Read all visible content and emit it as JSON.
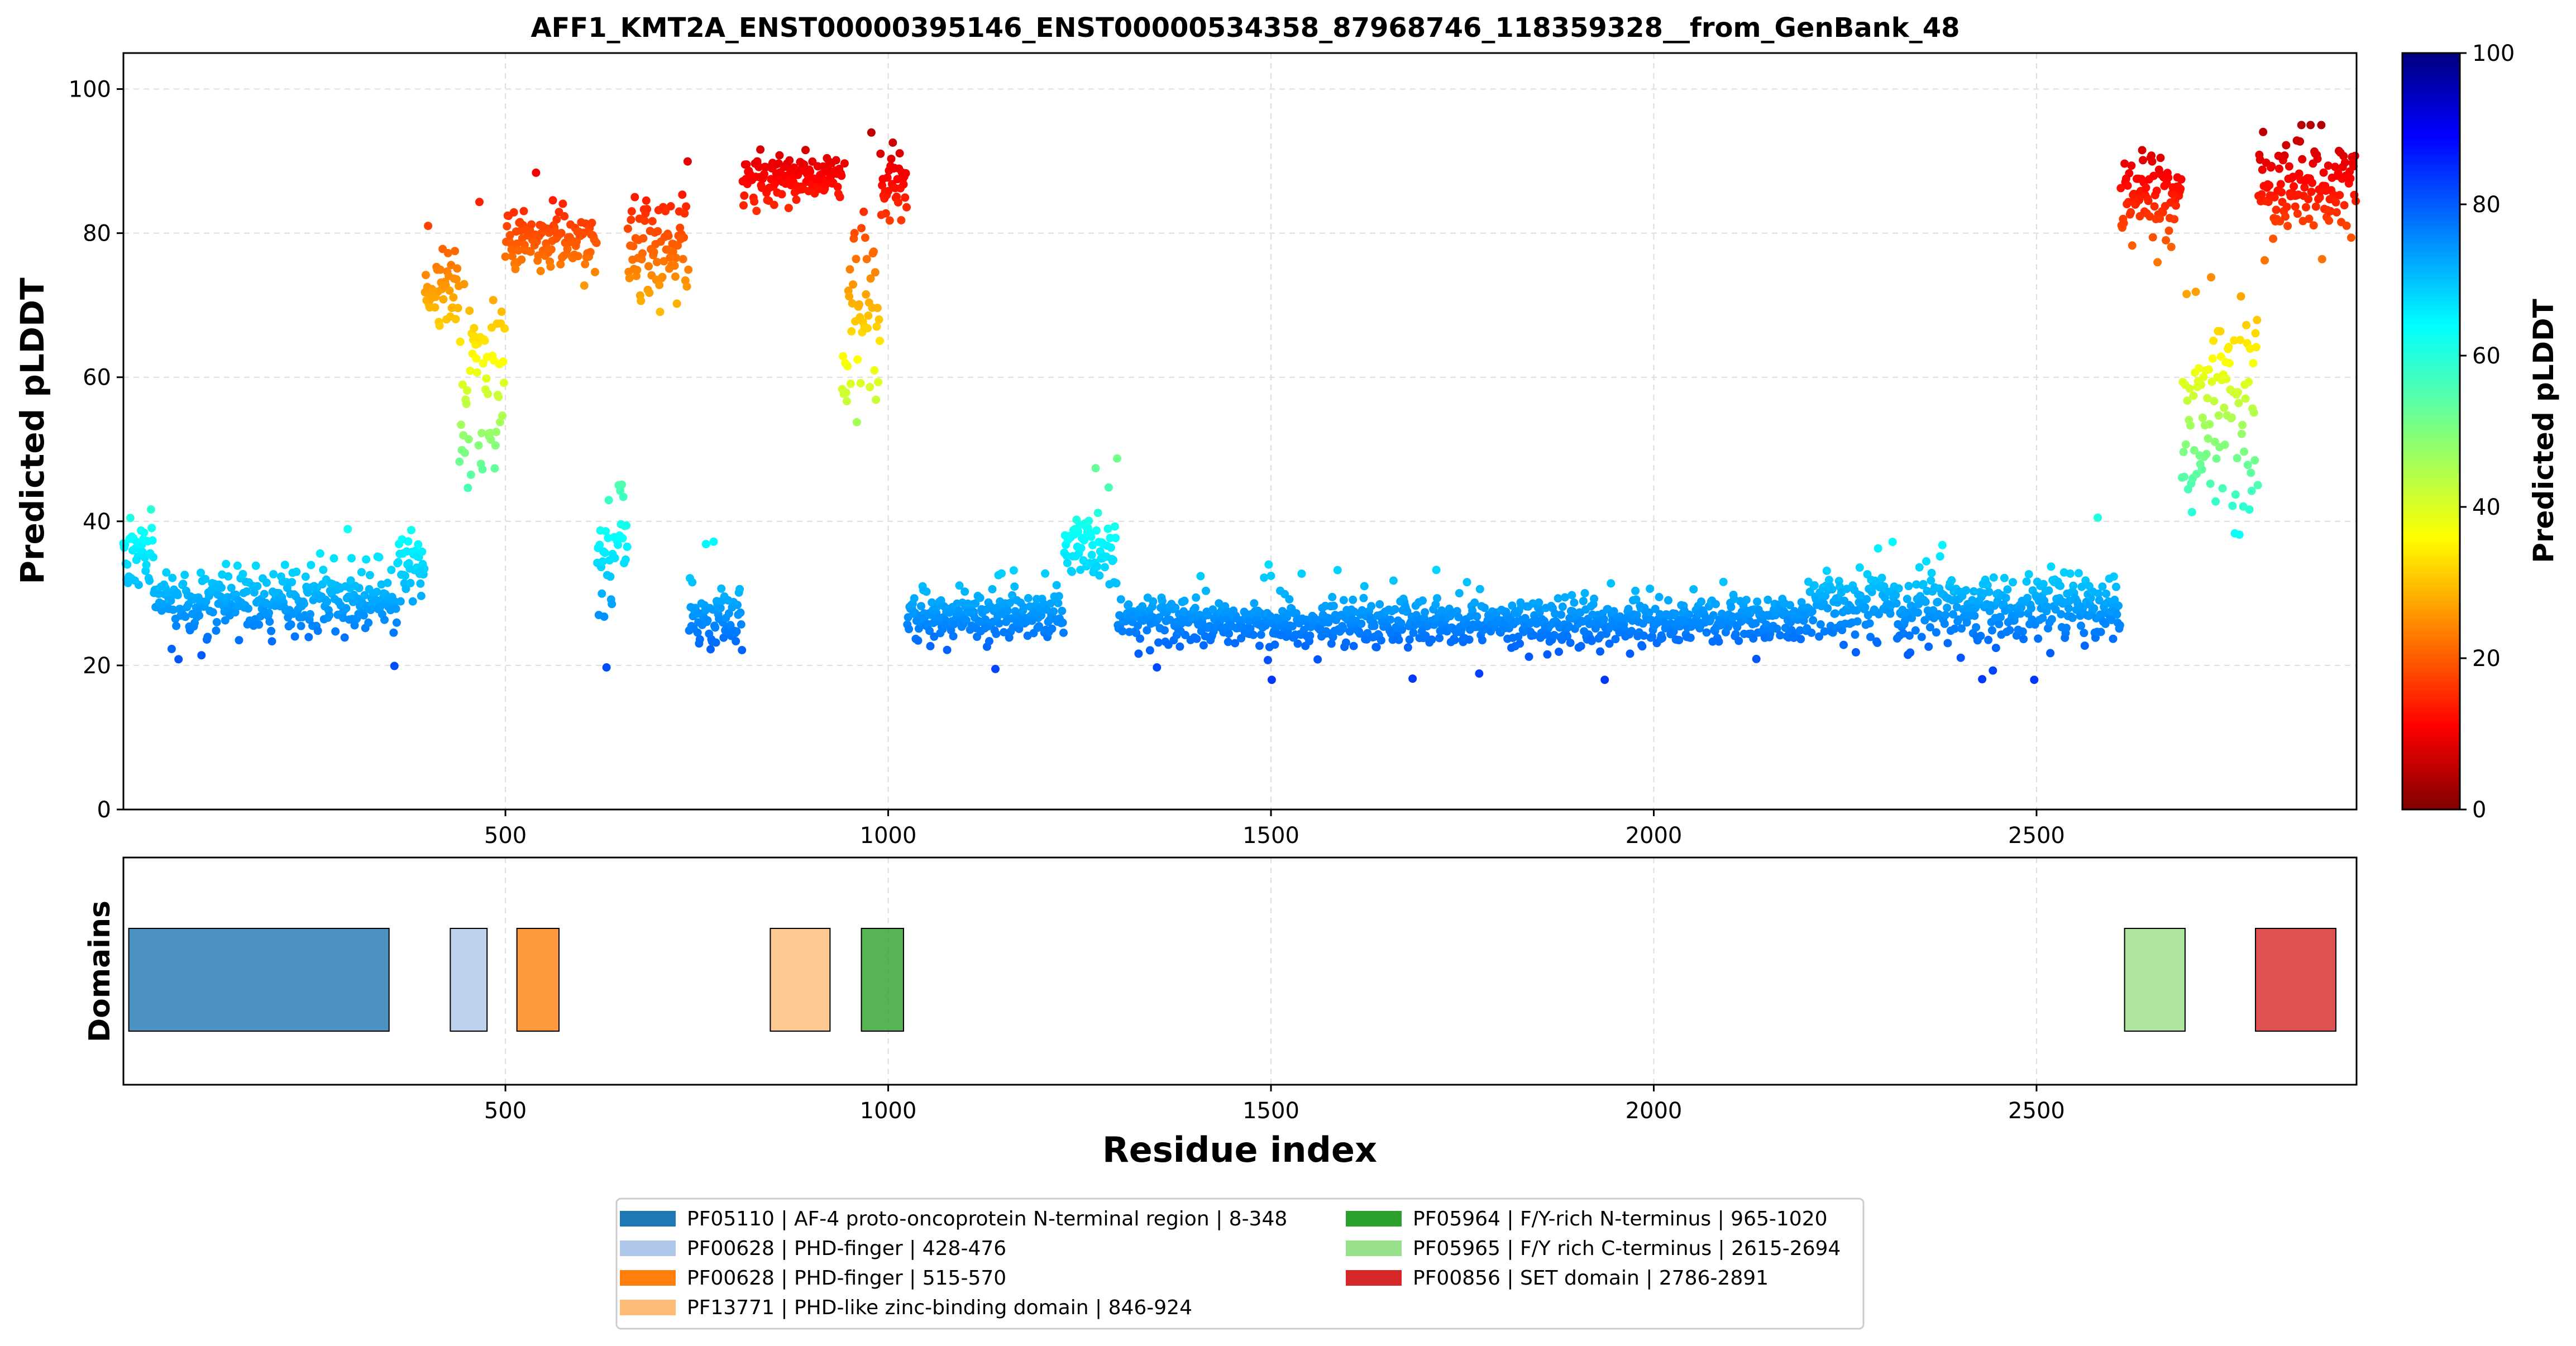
{
  "chart_data": {
    "type": "scatter",
    "title": "AFF1_KMT2A_ENST00000395146_ENST00000534358_87968746_118359328__from_GenBank_48",
    "xlabel": "Residue index",
    "ylabel": "Predicted pLDDT",
    "domain_panel_ylabel": "Domains",
    "xlim": [
      1,
      2918
    ],
    "ylim": [
      0,
      105
    ],
    "xticks": [
      500,
      1000,
      1500,
      2000,
      2500
    ],
    "yticks": [
      0,
      20,
      40,
      60,
      80,
      100
    ],
    "grid": true,
    "colorscale": "jet",
    "colorbar": {
      "label": "Predicted pLDDT",
      "range": [
        0,
        100
      ],
      "ticks": [
        0,
        20,
        40,
        60,
        80,
        100
      ]
    },
    "segments": [
      {
        "start": 1,
        "end": 40,
        "mean": 36,
        "spread": 6
      },
      {
        "start": 40,
        "end": 360,
        "mean": 29,
        "spread": 4
      },
      {
        "start": 360,
        "end": 395,
        "mean": 34,
        "spread": 5
      },
      {
        "start": 395,
        "end": 440,
        "mean": 72,
        "spread": 5
      },
      {
        "start": 440,
        "end": 500,
        "mean": 58,
        "spread": 12
      },
      {
        "start": 500,
        "end": 620,
        "mean": 79,
        "spread": 4
      },
      {
        "start": 620,
        "end": 660,
        "mean": 36,
        "spread": 7
      },
      {
        "start": 660,
        "end": 740,
        "mean": 78,
        "spread": 7
      },
      {
        "start": 740,
        "end": 810,
        "mean": 27,
        "spread": 4
      },
      {
        "start": 810,
        "end": 940,
        "mean": 88,
        "spread": 3
      },
      {
        "start": 940,
        "end": 990,
        "mean": 70,
        "spread": 14
      },
      {
        "start": 990,
        "end": 1025,
        "mean": 86,
        "spread": 4
      },
      {
        "start": 1025,
        "end": 1230,
        "mean": 27,
        "spread": 3
      },
      {
        "start": 1230,
        "end": 1300,
        "mean": 37,
        "spread": 5
      },
      {
        "start": 1300,
        "end": 2200,
        "mean": 26,
        "spread": 3
      },
      {
        "start": 2200,
        "end": 2610,
        "mean": 28,
        "spread": 4
      },
      {
        "start": 2610,
        "end": 2690,
        "mean": 85,
        "spread": 5
      },
      {
        "start": 2690,
        "end": 2790,
        "mean": 55,
        "spread": 15
      },
      {
        "start": 2790,
        "end": 2918,
        "mean": 86,
        "spread": 6
      }
    ],
    "domains": [
      {
        "label": "PF05110 | AF-4 proto-oncoprotein N-terminal region | 8-348",
        "start": 8,
        "end": 348,
        "color": "#1f77b4"
      },
      {
        "label": "PF00628 | PHD-finger | 428-476",
        "start": 428,
        "end": 476,
        "color": "#aec7e8"
      },
      {
        "label": "PF00628 | PHD-finger | 515-570",
        "start": 515,
        "end": 570,
        "color": "#ff7f0e"
      },
      {
        "label": "PF13771 | PHD-like zinc-binding domain | 846-924",
        "start": 846,
        "end": 924,
        "color": "#ffbb78"
      },
      {
        "label": "PF05964 | F/Y-rich N-terminus | 965-1020",
        "start": 965,
        "end": 1020,
        "color": "#2ca02c"
      },
      {
        "label": "PF05965 | F/Y rich C-terminus | 2615-2694",
        "start": 2615,
        "end": 2694,
        "color": "#98df8a"
      },
      {
        "label": "PF00856 | SET domain | 2786-2891",
        "start": 2786,
        "end": 2891,
        "color": "#d62728"
      }
    ]
  }
}
